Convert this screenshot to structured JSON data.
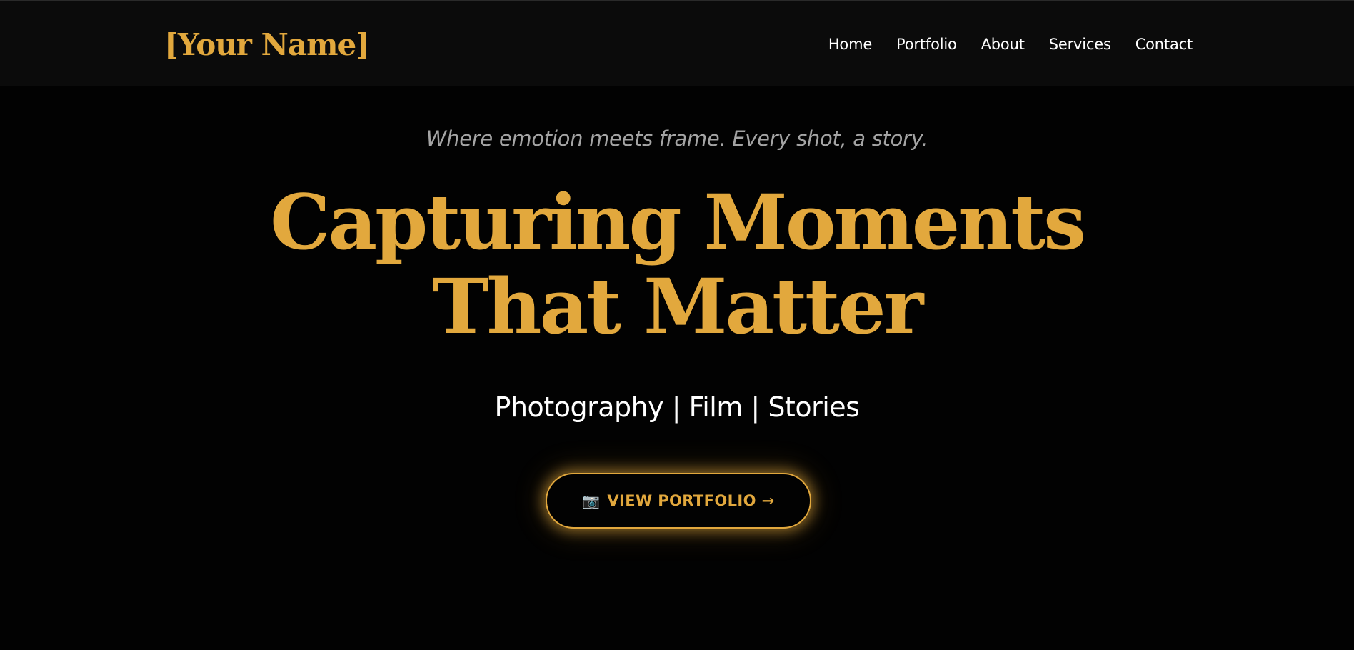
{
  "header": {
    "brand": "[Your Name]",
    "nav": [
      {
        "label": "Home"
      },
      {
        "label": "Portfolio"
      },
      {
        "label": "About"
      },
      {
        "label": "Services"
      },
      {
        "label": "Contact"
      }
    ]
  },
  "hero": {
    "tagline": "Where emotion meets frame. Every shot, a story.",
    "headline_line1": "Capturing Moments",
    "headline_line2": "That Matter",
    "subtitle": "Photography | Film | Stories",
    "cta": {
      "icon": "camera-icon",
      "icon_glyph": "📷",
      "label": "VIEW PORTFOLIO →"
    }
  },
  "colors": {
    "accent": "#e2a83d",
    "background": "#020202",
    "navbar_background": "#0b0b0b",
    "text": "#ffffff",
    "muted_text": "#a4a4a4"
  }
}
